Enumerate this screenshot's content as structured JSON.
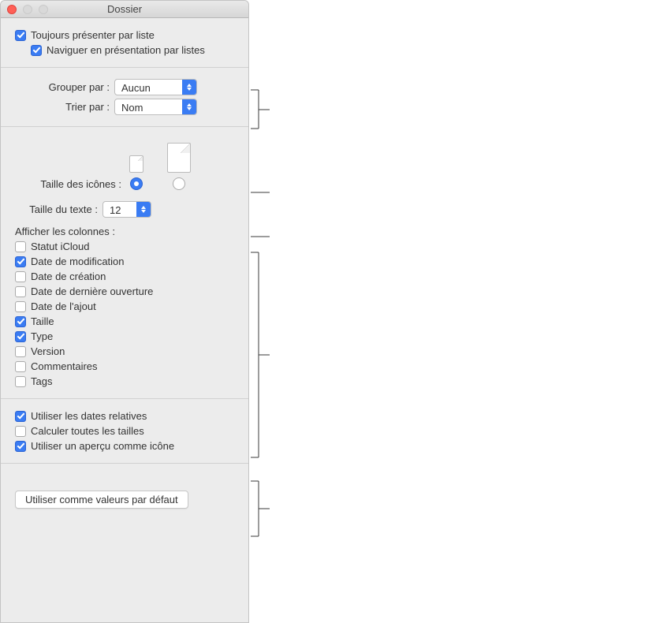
{
  "title": "Dossier",
  "top_checks": {
    "always_list": {
      "label": "Toujours présenter par liste",
      "checked": true
    },
    "browse_list": {
      "label": "Naviguer en présentation par listes",
      "checked": true
    }
  },
  "grouping": {
    "group_by_label": "Grouper par :",
    "group_by_value": "Aucun",
    "sort_by_label": "Trier par :",
    "sort_by_value": "Nom"
  },
  "icon_size": {
    "label": "Taille des icônes :",
    "selected": "small"
  },
  "text_size": {
    "label": "Taille du texte :",
    "value": "12"
  },
  "columns": {
    "header": "Afficher les colonnes :",
    "items": [
      {
        "label": "Statut iCloud",
        "checked": false
      },
      {
        "label": "Date de modification",
        "checked": true
      },
      {
        "label": "Date de création",
        "checked": false
      },
      {
        "label": "Date de dernière ouverture",
        "checked": false
      },
      {
        "label": "Date de l'ajout",
        "checked": false
      },
      {
        "label": "Taille",
        "checked": true
      },
      {
        "label": "Type",
        "checked": true
      },
      {
        "label": "Version",
        "checked": false
      },
      {
        "label": "Commentaires",
        "checked": false
      },
      {
        "label": "Tags",
        "checked": false
      }
    ]
  },
  "bottom_checks": [
    {
      "label": "Utiliser les dates relatives",
      "checked": true
    },
    {
      "label": "Calculer toutes les tailles",
      "checked": false
    },
    {
      "label": "Utiliser un aperçu comme icône",
      "checked": true
    }
  ],
  "default_button": "Utiliser comme valeurs par défaut"
}
